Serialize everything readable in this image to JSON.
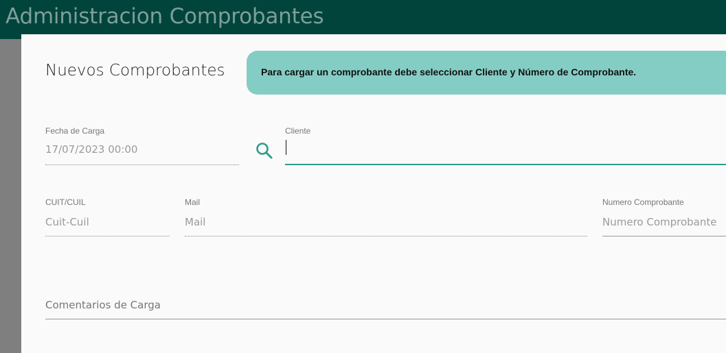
{
  "header": {
    "title": "Administracion Comprobantes"
  },
  "modal": {
    "title": "Nuevos Comprobantes",
    "info_message": "Para cargar un comprobante debe seleccionar Cliente y Número de Comprobante."
  },
  "form": {
    "fecha_carga": {
      "label": "Fecha de Carga",
      "value": "17/07/2023 00:00"
    },
    "cliente": {
      "label": "Cliente",
      "value": ""
    },
    "cuit": {
      "label": "CUIT/CUIL",
      "placeholder": "Cuit-Cuil"
    },
    "mail": {
      "label": "Mail",
      "placeholder": "Mail"
    },
    "numero": {
      "label": "Numero Comprobante",
      "placeholder": "Numero Comprobante"
    },
    "comentarios": {
      "placeholder": "Comentarios de Carga"
    }
  },
  "icons": {
    "search": "search-icon"
  },
  "colors": {
    "header_bg": "#00443c",
    "header_text": "#7d9f99",
    "accent": "#2d9c8f",
    "banner_bg": "#84cdc4"
  }
}
